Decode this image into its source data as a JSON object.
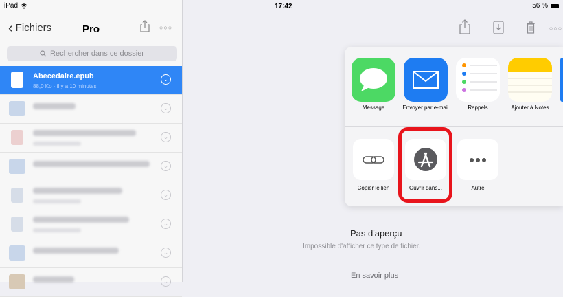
{
  "status": {
    "device": "iPad",
    "time": "17:42",
    "battery": "56 %"
  },
  "nav": {
    "back_label": "Fichiers",
    "title": "Pro"
  },
  "search": {
    "placeholder": "Rechercher dans ce dossier"
  },
  "files": [
    {
      "name": "Abecedaire.epub",
      "meta": "88,0 Ko · il y a 10 minutes",
      "selected": true
    },
    {
      "name": "",
      "blurred": true
    },
    {
      "name": "",
      "blurred": true
    },
    {
      "name": "",
      "blurred": true
    },
    {
      "name": "",
      "blurred": true
    },
    {
      "name": "",
      "blurred": true
    },
    {
      "name": "",
      "blurred": true
    },
    {
      "name": "",
      "blurred": true
    }
  ],
  "share_sheet": {
    "apps": [
      {
        "label": "Message",
        "icon": "messages-icon",
        "color": "#4cd964"
      },
      {
        "label": "Envoyer par e-mail",
        "icon": "mail-icon",
        "color": "#1e7cf2"
      },
      {
        "label": "Rappels",
        "icon": "reminders-icon",
        "color": "#ffffff"
      },
      {
        "label": "Ajouter à Notes",
        "icon": "notes-icon",
        "color": "#ffcc00"
      }
    ],
    "actions": [
      {
        "label": "Copier le lien",
        "icon": "link-icon"
      },
      {
        "label": "Ouvrir dans...",
        "icon": "app-store-icon"
      },
      {
        "label": "Autre",
        "icon": "more-icon"
      }
    ]
  },
  "preview": {
    "title": "Pas d'aperçu",
    "subtitle": "Impossible d'afficher ce type de fichier.",
    "link": "En savoir plus"
  },
  "colors": {
    "accent": "#2f86f6",
    "highlight": "#e8141c"
  }
}
